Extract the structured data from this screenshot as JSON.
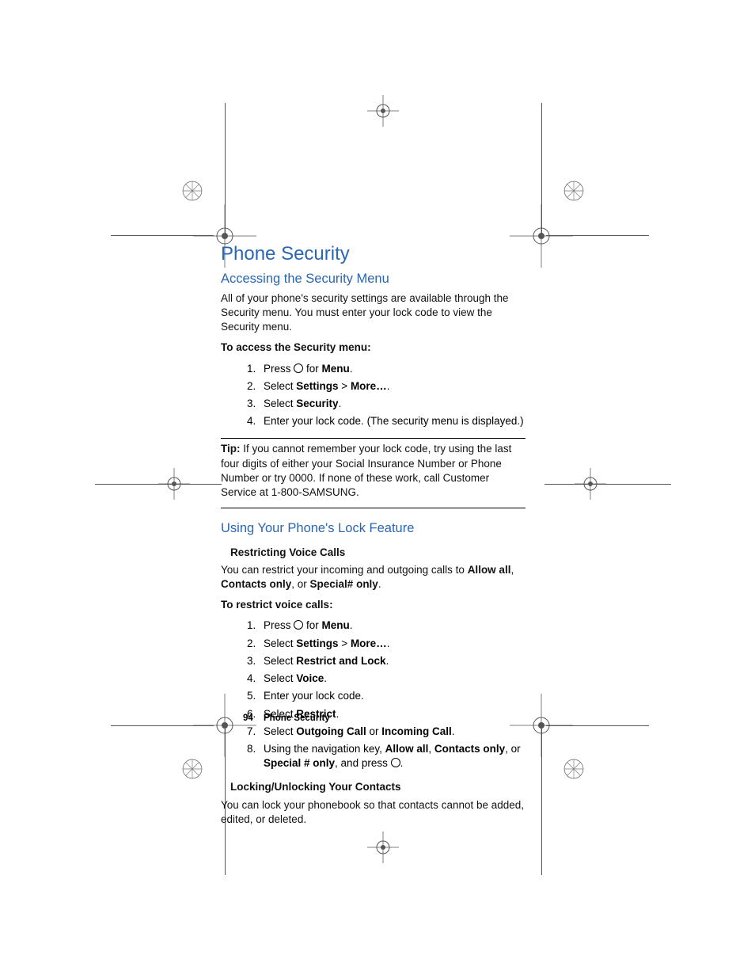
{
  "title": "Phone Security",
  "section1": {
    "heading": "Accessing the Security Menu",
    "intro": "All of your phone's security settings are available through the Security menu. You must enter your lock code to view the Security menu.",
    "subhead": "To access the Security menu:",
    "steps": {
      "s1_a": "Press ",
      "s1_b": " for ",
      "s1_menu": "Menu",
      "s1_end": ".",
      "s2_a": "Select ",
      "s2_settings": "Settings",
      "s2_gt": " > ",
      "s2_more": "More…",
      "s2_end": ".",
      "s3_a": "Select ",
      "s3_sec": "Security",
      "s3_end": ".",
      "s4": "Enter your lock code. (The security menu is displayed.)"
    },
    "tip_label": "Tip:",
    "tip_text": " If you cannot remember your lock code, try using the last four digits of either your Social Insurance Number or Phone Number or try 0000. If none of these work, call Customer Service at 1-800-SAMSUNG."
  },
  "section2": {
    "heading": "Using Your Phone's Lock Feature",
    "sub1": "Restricting Voice Calls",
    "intro_a": "You can restrict your incoming and outgoing calls to ",
    "intro_allow": "Allow all",
    "intro_comma1": ", ",
    "intro_contacts": "Contacts only",
    "intro_comma2": ", or ",
    "intro_special": "Special# only",
    "intro_end": ".",
    "subhead2": "To restrict voice calls:",
    "steps": {
      "s1_a": "Press ",
      "s1_b": " for ",
      "s1_menu": "Menu",
      "s1_end": ".",
      "s2_a": "Select ",
      "s2_settings": "Settings",
      "s2_gt": " > ",
      "s2_more": "More…",
      "s2_end": ".",
      "s3_a": "Select ",
      "s3_b": "Restrict and Lock",
      "s3_end": ".",
      "s4_a": "Select ",
      "s4_b": "Voice",
      "s4_end": ".",
      "s5": "Enter your lock code.",
      "s6_a": "Select ",
      "s6_b": "Restrict",
      "s6_end": ".",
      "s7_a": "Select ",
      "s7_b": "Outgoing Call",
      "s7_or": " or ",
      "s7_c": "Incoming Call",
      "s7_end": ".",
      "s8_a": "Using the navigation key, ",
      "s8_allow": "Allow all",
      "s8_c1": ", ",
      "s8_contacts": "Contacts only",
      "s8_c2": ", or ",
      "s8_special": "Special # only",
      "s8_press": ", and press ",
      "s8_end": "."
    },
    "sub2": "Locking/Unlocking Your Contacts",
    "sub2_text": "You can lock your phonebook so that contacts cannot be added, edited, or deleted."
  },
  "footer": {
    "page": "94",
    "title": "Phone Security"
  }
}
